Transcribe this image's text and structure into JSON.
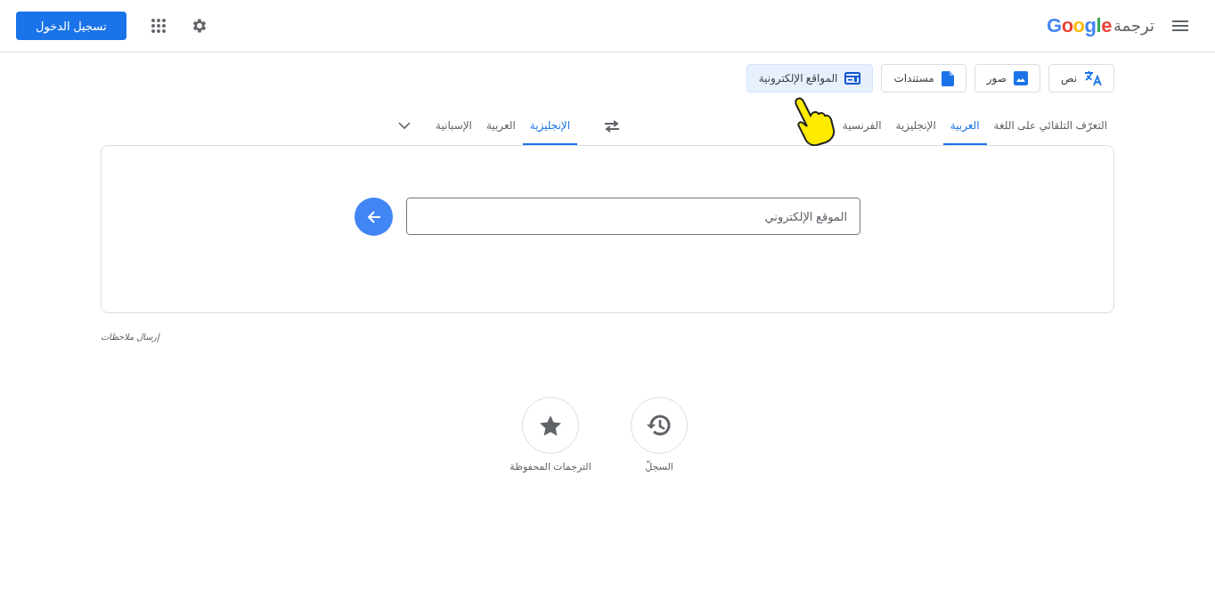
{
  "header": {
    "logo": "Google",
    "product": "ترجمة",
    "sign_in": "تسجيل الدخول"
  },
  "modes": [
    {
      "label": "نص",
      "kind": "text",
      "selected": false
    },
    {
      "label": "صور",
      "kind": "images",
      "selected": false
    },
    {
      "label": "مستندات",
      "kind": "documents",
      "selected": false
    },
    {
      "label": "المواقع الإلكترونية",
      "kind": "websites",
      "selected": true
    }
  ],
  "source_languages": [
    {
      "label": "التعرّف التلقائي على اللغة",
      "selected": false
    },
    {
      "label": "العربية",
      "selected": true
    },
    {
      "label": "الإنجليزية",
      "selected": false
    },
    {
      "label": "الفرنسية",
      "selected": false
    }
  ],
  "target_languages": [
    {
      "label": "الإنجليزية",
      "selected": true
    },
    {
      "label": "العربية",
      "selected": false
    },
    {
      "label": "الإسبانية",
      "selected": false
    }
  ],
  "website_input": {
    "value": "الموقع الإلكتروني"
  },
  "feedback": "إرسال ملاحظات",
  "shortcuts": [
    {
      "label": "السجلّ",
      "kind": "history"
    },
    {
      "label": "الترجمات المحفوظة",
      "kind": "saved"
    }
  ]
}
